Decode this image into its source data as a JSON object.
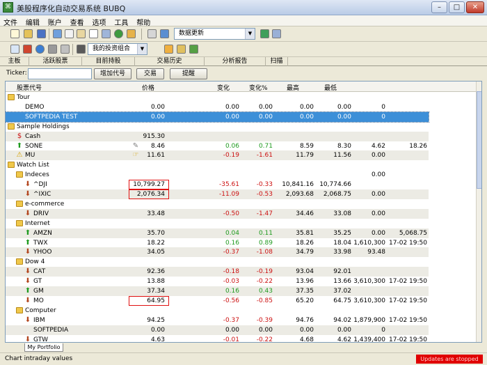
{
  "window": {
    "title": "美股程序化自动交易系统 BUBQ",
    "minimize": "–",
    "maximize": "□",
    "close": "✕"
  },
  "menu": [
    "文件",
    "编辑",
    "账户",
    "查看",
    "选项",
    "工具",
    "帮助"
  ],
  "toolbar": {
    "data_update_label": "数据更新",
    "portfolio_label": "我的投资组合"
  },
  "tabs": [
    "主板",
    "活跃股票",
    "目前持股",
    "交易历史",
    "分析报告",
    "扫描"
  ],
  "ticker_bar": {
    "label": "Ticker:",
    "input_value": "",
    "add_button": "增加代号",
    "trade_button": "交易",
    "alert_button": "提醒"
  },
  "columns": [
    "股票代号",
    "价格",
    "变化",
    "变化%",
    "最高",
    "最低"
  ],
  "rows": [
    {
      "kind": "group",
      "level": 0,
      "name": "Tour"
    },
    {
      "kind": "item",
      "level": 1,
      "icon": "none",
      "name": "DEMO",
      "price": "0.00",
      "chg": "0.00",
      "chgp": "0.00",
      "high": "0.00",
      "low": "0.00",
      "c7": "0",
      "c8": "",
      "dir": ""
    },
    {
      "kind": "item",
      "level": 1,
      "icon": "none",
      "name": "SOFTPEDIA TEST",
      "price": "0.00",
      "chg": "0.00",
      "chgp": "0.00",
      "high": "0.00",
      "low": "0.00",
      "c7": "0",
      "c8": "",
      "dir": "",
      "selected": true
    },
    {
      "kind": "group",
      "level": 0,
      "name": "Sample Holdings"
    },
    {
      "kind": "item",
      "level": 1,
      "icon": "cash",
      "name": "Cash",
      "price": "915.30",
      "chg": "",
      "chgp": "",
      "high": "",
      "low": "",
      "c7": "",
      "c8": "",
      "dir": ""
    },
    {
      "kind": "item",
      "level": 1,
      "icon": "up",
      "name": "SONE",
      "price": "8.46",
      "chg": "0.06",
      "chgp": "0.71",
      "high": "8.59",
      "low": "8.30",
      "c7": "4.62",
      "c8": "18.26",
      "dir": "pos",
      "mark": true
    },
    {
      "kind": "item",
      "level": 1,
      "icon": "warn",
      "name": "MU",
      "price": "11.61",
      "chg": "-0.19",
      "chgp": "-1.61",
      "high": "11.79",
      "low": "11.56",
      "c7": "0.00",
      "c8": "",
      "dir": "neg",
      "mark": true
    },
    {
      "kind": "group",
      "level": 0,
      "name": "Watch List"
    },
    {
      "kind": "group",
      "level": 1,
      "name": "Indeces",
      "c7": "0.00"
    },
    {
      "kind": "item",
      "level": 2,
      "icon": "down",
      "name": "^DJI",
      "price": "10,799.27",
      "chg": "-35.61",
      "chgp": "-0.33",
      "high": "10,841.16",
      "low": "10,774.66",
      "c7": "",
      "c8": "",
      "dir": "neg",
      "boxed": true
    },
    {
      "kind": "item",
      "level": 2,
      "icon": "down",
      "name": "^IXIC",
      "price": "2,076.34",
      "chg": "-11.09",
      "chgp": "-0.53",
      "high": "2,093.68",
      "low": "2,068.75",
      "c7": "0.00",
      "c8": "",
      "dir": "neg",
      "boxed": true
    },
    {
      "kind": "group",
      "level": 1,
      "name": "e-commerce"
    },
    {
      "kind": "item",
      "level": 2,
      "icon": "down",
      "name": "DRIV",
      "price": "33.48",
      "chg": "-0.50",
      "chgp": "-1.47",
      "high": "34.46",
      "low": "33.08",
      "c7": "0.00",
      "c8": "",
      "dir": "neg"
    },
    {
      "kind": "group",
      "level": 1,
      "name": "Internet"
    },
    {
      "kind": "item",
      "level": 2,
      "icon": "up",
      "name": "AMZN",
      "price": "35.70",
      "chg": "0.04",
      "chgp": "0.11",
      "high": "35.81",
      "low": "35.25",
      "c7": "0.00",
      "c8": "5,068.75",
      "dir": "pos"
    },
    {
      "kind": "item",
      "level": 2,
      "icon": "up",
      "name": "TWX",
      "price": "18.22",
      "chg": "0.16",
      "chgp": "0.89",
      "high": "18.26",
      "low": "18.04",
      "c7": "1,610,300",
      "c8": "17-02 19:50",
      "dir": "pos"
    },
    {
      "kind": "item",
      "level": 2,
      "icon": "down",
      "name": "YHOO",
      "price": "34.05",
      "chg": "-0.37",
      "chgp": "-1.08",
      "high": "34.79",
      "low": "33.98",
      "c7": "93.48",
      "c8": "",
      "dir": "neg"
    },
    {
      "kind": "group",
      "level": 1,
      "name": "Dow 4"
    },
    {
      "kind": "item",
      "level": 2,
      "icon": "down",
      "name": "CAT",
      "price": "92.36",
      "chg": "-0.18",
      "chgp": "-0.19",
      "high": "93.04",
      "low": "92.01",
      "c7": "",
      "c8": "",
      "dir": "neg"
    },
    {
      "kind": "item",
      "level": 2,
      "icon": "down",
      "name": "GT",
      "price": "13.88",
      "chg": "-0.03",
      "chgp": "-0.22",
      "high": "13.96",
      "low": "13.66",
      "c7": "3,610,300",
      "c8": "17-02 19:50",
      "dir": "neg"
    },
    {
      "kind": "item",
      "level": 2,
      "icon": "up",
      "name": "GM",
      "price": "37.34",
      "chg": "0.16",
      "chgp": "0.43",
      "high": "37.35",
      "low": "37.02",
      "c7": "",
      "c8": "",
      "dir": "pos"
    },
    {
      "kind": "item",
      "level": 2,
      "icon": "down",
      "name": "MO",
      "price": "64.95",
      "chg": "-0.56",
      "chgp": "-0.85",
      "high": "65.20",
      "low": "64.75",
      "c7": "3,610,300",
      "c8": "17-02 19:50",
      "dir": "neg",
      "boxed": true
    },
    {
      "kind": "group",
      "level": 1,
      "name": "Computer"
    },
    {
      "kind": "item",
      "level": 2,
      "icon": "down",
      "name": "IBM",
      "price": "94.25",
      "chg": "-0.37",
      "chgp": "-0.39",
      "high": "94.76",
      "low": "94.02",
      "c7": "1,879,900",
      "c8": "17-02 19:50",
      "dir": "neg"
    },
    {
      "kind": "item",
      "level": 2,
      "icon": "none",
      "name": "SOFTPEDIA",
      "price": "0.00",
      "chg": "0.00",
      "chgp": "0.00",
      "high": "0.00",
      "low": "0.00",
      "c7": "0",
      "c8": "",
      "dir": ""
    },
    {
      "kind": "item",
      "level": 2,
      "icon": "down",
      "name": "GTW",
      "price": "4.63",
      "chg": "-0.01",
      "chgp": "-0.22",
      "high": "4.68",
      "low": "4.62",
      "c7": "1,439,400",
      "c8": "17-02 19:50",
      "dir": "neg"
    }
  ],
  "sheet_tab": "My Portfolio",
  "status": {
    "message": "Chart intraday values",
    "warning": "Updates are stopped"
  },
  "colors": {
    "positive": "#1e9a1e",
    "negative": "#cc1010",
    "selection": "#3c8fd8"
  }
}
